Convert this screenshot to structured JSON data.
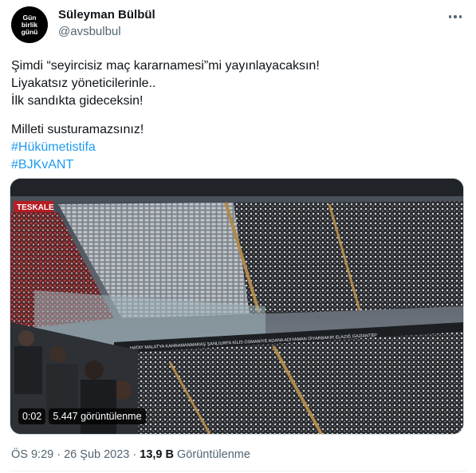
{
  "author": {
    "avatar_lines": [
      "Gün",
      "birlik",
      "günü"
    ],
    "name": "Süleyman Bülbül",
    "handle": "@avsbulbul"
  },
  "tweet": {
    "lines": [
      "Şimdi “seyircisiz maç kararnamesi”mi yayınlayacaksın!",
      "Liyakatsız yöneticilerinle..",
      "İlk sandıkta gideceksin!",
      "Milleti susturamazsınız!"
    ],
    "hashtags": [
      "#Hükümetistifa",
      "#BJKvANT"
    ]
  },
  "media": {
    "type": "video",
    "time": "0:02",
    "views": "5.447 görüntülenme",
    "stadium_sign": "TESKALE",
    "banner_text": "HATAY MALATYA KAHRAMANMARAŞ ŞANLIURFA KİLİS OSMANİYE ADANA ADIYAMAN DİYARBAKIR ELAZIĞ GAZİANTEP"
  },
  "footer": {
    "time": "ÖS 9:29",
    "sep": "·",
    "date": "26 Şub 2023",
    "views_count": "13,9 B",
    "views_label": "Görüntülenme"
  }
}
